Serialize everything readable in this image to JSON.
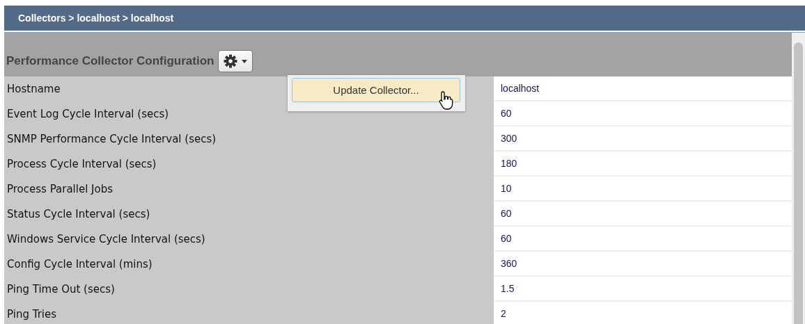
{
  "breadcrumb": "Collectors > localhost > localhost",
  "panel": {
    "title": "Performance Collector Configuration",
    "menu": {
      "items": [
        {
          "label": "Update Collector...",
          "selected": true
        }
      ]
    },
    "rows": [
      {
        "label": "Hostname",
        "value": "localhost"
      },
      {
        "label": "Event Log Cycle Interval (secs)",
        "value": "60"
      },
      {
        "label": "SNMP Performance Cycle Interval (secs)",
        "value": "300"
      },
      {
        "label": "Process Cycle Interval (secs)",
        "value": "180"
      },
      {
        "label": "Process Parallel Jobs",
        "value": "10"
      },
      {
        "label": "Status Cycle Interval (secs)",
        "value": "60"
      },
      {
        "label": "Windows Service Cycle Interval (secs)",
        "value": "60"
      },
      {
        "label": "Config Cycle Interval (mins)",
        "value": "360"
      },
      {
        "label": "Ping Time Out (secs)",
        "value": "1.5"
      },
      {
        "label": "Ping Tries",
        "value": "2"
      }
    ]
  }
}
